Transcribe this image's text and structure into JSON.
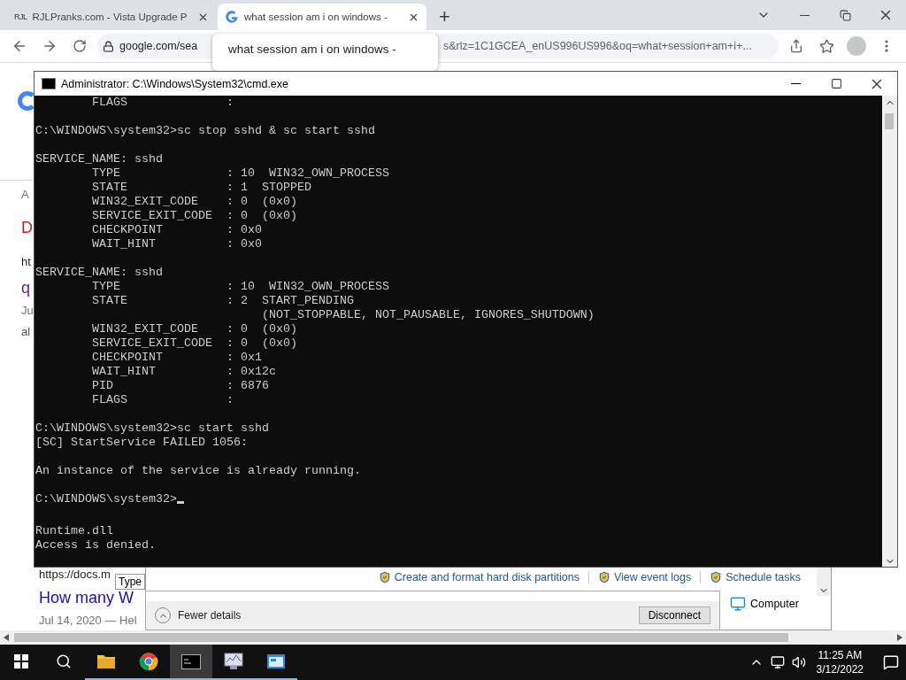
{
  "browser": {
    "tabs": [
      {
        "favicon_text": "RJL",
        "title": "RJLPranks.com - Vista Upgrade P",
        "selected": false
      },
      {
        "title": "what session am i on windows -",
        "selected": true
      }
    ],
    "new_tab": "+",
    "address": {
      "host": "google.com/sea",
      "rest": "s&rlz=1C1GCEA_enUS996US996&oq=what+session+am+i+..."
    },
    "tooltip": {
      "lines": [
        "what session am i on windows -"
      ]
    },
    "page_top": [
      {
        "kind": "meta",
        "text": "A"
      },
      {
        "kind": "heading",
        "text": "D"
      },
      {
        "kind": "url",
        "text": "ht"
      },
      {
        "kind": "visited",
        "text": "q"
      },
      {
        "kind": "meta",
        "text": "Ju"
      },
      {
        "kind": "snippet",
        "text": "al"
      }
    ],
    "page_bottom": [
      {
        "kind": "url",
        "text": "https://docs.m"
      },
      {
        "kind": "link",
        "text": "How many W"
      },
      {
        "kind": "meta",
        "text": "Jul 14, 2020 — Hel"
      }
    ]
  },
  "server_window": {
    "hint": "Type",
    "links": [
      "Create and format hard disk partitions",
      "View event logs",
      "Schedule tasks"
    ],
    "item": "Computer"
  },
  "task_window": {
    "toggle": "Fewer details",
    "button": "Disconnect"
  },
  "cmd": {
    "title": "Administrator: C:\\Windows\\System32\\cmd.exe",
    "blocks": [
      [
        "        FLAGS              :"
      ],
      [
        "C:\\WINDOWS\\system32>sc stop sshd & sc start sshd"
      ],
      [
        "SERVICE_NAME: sshd",
        "        TYPE               : 10  WIN32_OWN_PROCESS",
        "        STATE              : 1  STOPPED",
        "        WIN32_EXIT_CODE    : 0  (0x0)",
        "        SERVICE_EXIT_CODE  : 0  (0x0)",
        "        CHECKPOINT         : 0x0",
        "        WAIT_HINT          : 0x0"
      ],
      [
        "SERVICE_NAME: sshd",
        "        TYPE               : 10  WIN32_OWN_PROCESS",
        "        STATE              : 2  START_PENDING",
        "                                (NOT_STOPPABLE, NOT_PAUSABLE, IGNORES_SHUTDOWN)",
        "        WIN32_EXIT_CODE    : 0  (0x0)",
        "        SERVICE_EXIT_CODE  : 0  (0x0)",
        "        CHECKPOINT         : 0x1",
        "        WAIT_HINT          : 0x12c",
        "        PID                : 6876",
        "        FLAGS              :"
      ],
      [
        "C:\\WINDOWS\\system32>sc start sshd",
        "[SC] StartService FAILED 1056:"
      ],
      [
        "An instance of the service is already running."
      ]
    ],
    "prompt": "C:\\WINDOWS\\system32>",
    "tail": [
      "Runtime.dll",
      "Access is denied."
    ]
  },
  "taskbar": {
    "apps": [
      {
        "kind": "files",
        "active": false
      },
      {
        "kind": "browser",
        "active": false
      },
      {
        "kind": "terminal",
        "active": true
      },
      {
        "kind": "monitor",
        "active": false
      },
      {
        "kind": "server",
        "active": false
      }
    ],
    "time": "11:25 AM",
    "date": "3/12/2022"
  }
}
